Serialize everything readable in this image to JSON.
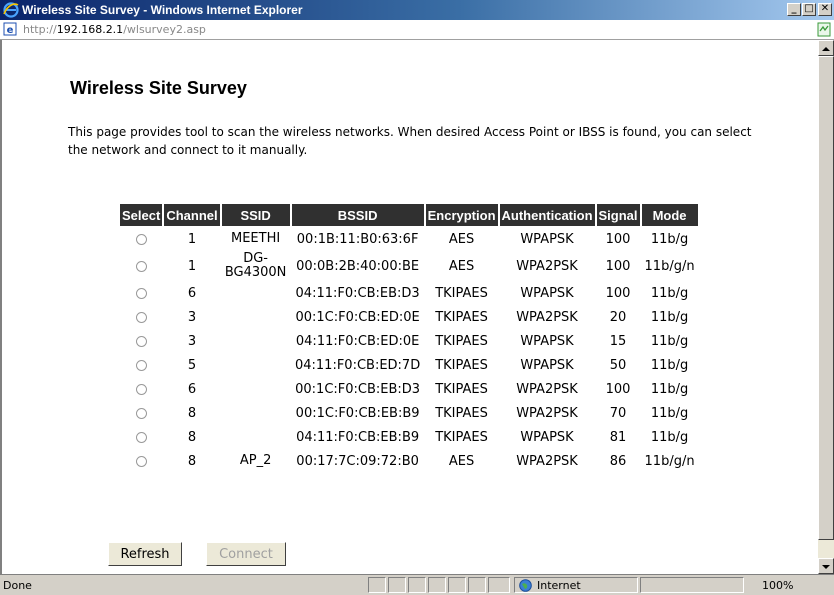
{
  "window": {
    "title": "Wireless Site Survey - Windows Internet Explorer",
    "min_glyph": "_",
    "max_glyph": "□",
    "close_glyph": "✕"
  },
  "address": {
    "scheme": "http://",
    "host": "192.168.2.1",
    "path": "/wlsurvey2.asp"
  },
  "page": {
    "heading": "Wireless Site Survey",
    "description": "This page provides tool to scan the wireless networks. When desired Access Point or IBSS is found, you can select the network and connect to it manually."
  },
  "table": {
    "headers": [
      "Select",
      "Channel",
      "SSID",
      "BSSID",
      "Encryption",
      "Authentication",
      "Signal",
      "Mode"
    ],
    "rows": [
      {
        "channel": "1",
        "ssid": "MEETHI",
        "bssid": "00:1B:11:B0:63:6F",
        "encryption": "AES",
        "authentication": "WPAPSK",
        "signal": "100",
        "mode": "11b/g"
      },
      {
        "channel": "1",
        "ssid": "DG-BG4300N",
        "bssid": "00:0B:2B:40:00:BE",
        "encryption": "AES",
        "authentication": "WPA2PSK",
        "signal": "100",
        "mode": "11b/g/n"
      },
      {
        "channel": "6",
        "ssid": "",
        "bssid": "04:11:F0:CB:EB:D3",
        "encryption": "TKIPAES",
        "authentication": "WPAPSK",
        "signal": "100",
        "mode": "11b/g"
      },
      {
        "channel": "3",
        "ssid": "",
        "bssid": "00:1C:F0:CB:ED:0E",
        "encryption": "TKIPAES",
        "authentication": "WPA2PSK",
        "signal": "20",
        "mode": "11b/g"
      },
      {
        "channel": "3",
        "ssid": "",
        "bssid": "04:11:F0:CB:ED:0E",
        "encryption": "TKIPAES",
        "authentication": "WPAPSK",
        "signal": "15",
        "mode": "11b/g"
      },
      {
        "channel": "5",
        "ssid": "",
        "bssid": "04:11:F0:CB:ED:7D",
        "encryption": "TKIPAES",
        "authentication": "WPAPSK",
        "signal": "50",
        "mode": "11b/g"
      },
      {
        "channel": "6",
        "ssid": "",
        "bssid": "00:1C:F0:CB:EB:D3",
        "encryption": "TKIPAES",
        "authentication": "WPA2PSK",
        "signal": "100",
        "mode": "11b/g"
      },
      {
        "channel": "8",
        "ssid": "",
        "bssid": "00:1C:F0:CB:EB:B9",
        "encryption": "TKIPAES",
        "authentication": "WPA2PSK",
        "signal": "70",
        "mode": "11b/g"
      },
      {
        "channel": "8",
        "ssid": "",
        "bssid": "04:11:F0:CB:EB:B9",
        "encryption": "TKIPAES",
        "authentication": "WPAPSK",
        "signal": "81",
        "mode": "11b/g"
      },
      {
        "channel": "8",
        "ssid": "AP_2",
        "bssid": "00:17:7C:09:72:B0",
        "encryption": "AES",
        "authentication": "WPA2PSK",
        "signal": "86",
        "mode": "11b/g/n"
      }
    ]
  },
  "buttons": {
    "refresh": "Refresh",
    "connect": "Connect"
  },
  "status": {
    "text": "Done",
    "zone": "Internet",
    "zoom": "100%"
  },
  "icons": {
    "browser": "ie-icon",
    "page": "page-icon",
    "compat": "compatibility-view-icon",
    "zone": "globe-icon"
  }
}
